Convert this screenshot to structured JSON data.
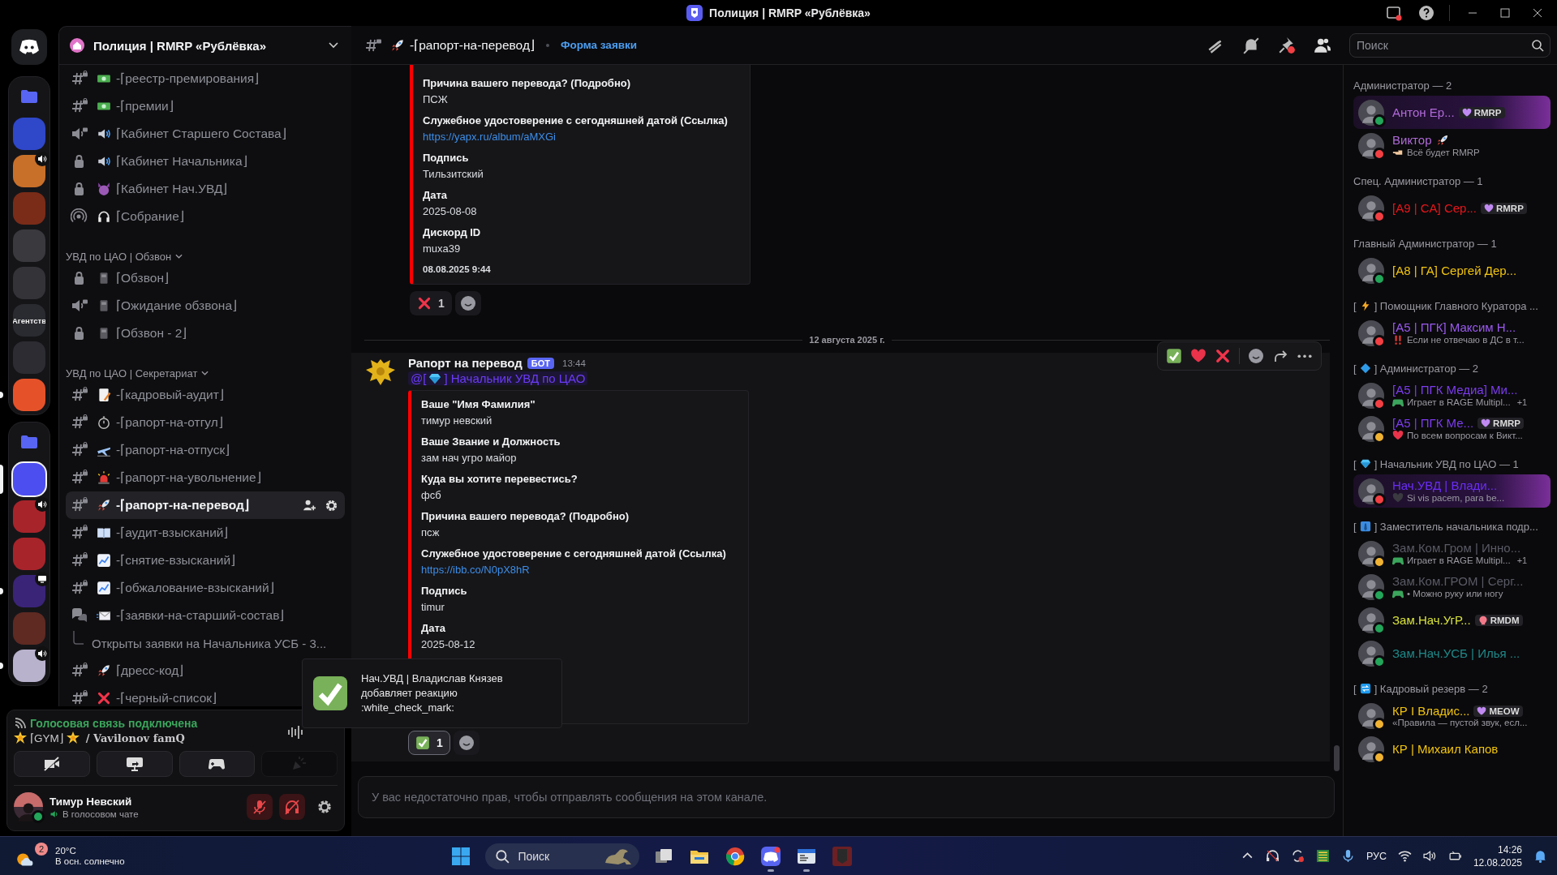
{
  "window": {
    "title": "Полиция | RMRP «Рублёвка»"
  },
  "rail": [
    {
      "kind": "home"
    },
    {
      "kind": "folder",
      "children": [
        {
          "color": "#2f47c9",
          "selected": false,
          "unread": false
        },
        {
          "color": "#c8702a",
          "selected": false,
          "unread": false,
          "activity": {
            "kind": "voice"
          }
        },
        {
          "color": "#7a2c18",
          "selected": false,
          "unread": false
        },
        {
          "color": "#3a3a3e",
          "selected": false,
          "unread": false
        },
        {
          "color": "#333338",
          "selected": false,
          "unread": false
        },
        {
          "color": "#2a2b30",
          "selected": false,
          "unread": false,
          "label": "Агентств"
        },
        {
          "color": "#2c2c32",
          "selected": false,
          "unread": false
        },
        {
          "color": "#e5522a",
          "selected": false,
          "unread": true
        }
      ]
    },
    {
      "kind": "folder",
      "children": [
        {
          "color": "#4d4ef0",
          "selected": true,
          "unread": false
        },
        {
          "color": "#a8242b",
          "selected": false,
          "unread": false,
          "activity": {
            "kind": "voice"
          }
        },
        {
          "color": "#a8242b",
          "selected": false,
          "unread": false
        },
        {
          "color": "#3a2478",
          "selected": false,
          "unread": true,
          "activity": {
            "kind": "screen"
          }
        },
        {
          "color": "#5e2a22",
          "selected": false,
          "unread": false
        },
        {
          "color": "#b9b2cc",
          "selected": false,
          "unread": true,
          "activity": {
            "kind": "voice"
          }
        }
      ]
    }
  ],
  "sidebar": {
    "server_name": "Полиция | RMRP «Рублёвка»",
    "categories": [
      {
        "channels": [
          {
            "kind": "text",
            "emoji": {
              "kind": "money"
            },
            "name": "-⌈реестр-премирования⌋",
            "selected": false
          },
          {
            "kind": "text",
            "emoji": {
              "kind": "money"
            },
            "name": "-⌈премии⌋",
            "selected": false
          },
          {
            "kind": "voice",
            "emoji": {
              "kind": "speaker"
            },
            "name": "⌈Кабинет Старшего Состава⌋",
            "selected": false
          },
          {
            "kind": "locked",
            "emoji": {
              "kind": "speaker"
            },
            "name": "⌈Кабинет Начальника⌋",
            "selected": false
          },
          {
            "kind": "locked",
            "emoji": {
              "kind": "devil"
            },
            "name": "⌈Кабинет Нач.УВД⌋",
            "selected": false
          },
          {
            "kind": "stage",
            "emoji": {
              "kind": "headphones"
            },
            "name": "⌈Собрание⌋",
            "selected": false
          }
        ]
      },
      {
        "name": "УВД по ЦАО | Обзвон",
        "expanded": true,
        "channels": [
          {
            "kind": "locked",
            "emoji": {
              "kind": "pager"
            },
            "name": "⌈Обзвон⌋",
            "selected": false
          },
          {
            "kind": "voice",
            "emoji": {
              "kind": "pager"
            },
            "name": "⌈Ожидание обзвона⌋",
            "selected": false
          },
          {
            "kind": "locked",
            "emoji": {
              "kind": "pager"
            },
            "name": "⌈Обзвон - 2⌋",
            "selected": false
          }
        ]
      },
      {
        "name": "УВД по ЦАО | Секретариат",
        "expanded": true,
        "channels": [
          {
            "kind": "text",
            "emoji": {
              "kind": "memo"
            },
            "name": "-⌈кадровый-аудит⌋",
            "selected": false
          },
          {
            "kind": "text",
            "emoji": {
              "kind": "timer"
            },
            "name": "-⌈рапорт-на-отгул⌋",
            "selected": false
          },
          {
            "kind": "text",
            "emoji": {
              "kind": "plane"
            },
            "name": "-⌈рапорт-на-отпуск⌋",
            "selected": false
          },
          {
            "kind": "text",
            "emoji": {
              "kind": "siren"
            },
            "name": "-⌈рапорт-на-увольнение⌋",
            "selected": false
          },
          {
            "kind": "text",
            "emoji": {
              "kind": "rocket"
            },
            "name": "-⌈рапорт-на-перевод⌋",
            "selected": true
          },
          {
            "kind": "text",
            "emoji": {
              "kind": "book"
            },
            "name": "-⌈аудит-взысканий⌋",
            "selected": false
          },
          {
            "kind": "text",
            "emoji": {
              "kind": "chart"
            },
            "name": "-⌈снятие-взысканий⌋",
            "selected": false
          },
          {
            "kind": "text",
            "emoji": {
              "kind": "chart"
            },
            "name": "-⌈обжалование-взысканий⌋",
            "selected": false
          },
          {
            "kind": "forum",
            "emoji": {
              "kind": "envelope"
            },
            "name": "-⌈заявки-на-старший-состав⌋",
            "selected": false,
            "children": [
              {
                "name": "Открыты заявки на Начальника УСБ - 3..."
              }
            ]
          },
          {
            "kind": "text",
            "emoji": {
              "kind": "rocket"
            },
            "name": "⌈дресс-код⌋",
            "selected": false
          },
          {
            "kind": "text",
            "emoji": {
              "kind": "cross"
            },
            "name": "-⌈черный-список⌋",
            "selected": false
          }
        ]
      }
    ]
  },
  "voice_panel": {
    "status": "Голосовая связь подключена",
    "channel": "⌈GYM⌋",
    "server": "/ Vavilonov famQ",
    "buttons": [
      {
        "kind": "camera",
        "disabled": false
      },
      {
        "kind": "screen",
        "disabled": false
      },
      {
        "kind": "activity",
        "disabled": false
      },
      {
        "kind": "soundboard",
        "disabled": true
      }
    ]
  },
  "user_panel": {
    "name": "Тимур Невский",
    "status_text": "В голосовом чате",
    "status": {
      "kind": "online"
    },
    "muted": true,
    "deafened": true
  },
  "channel_header": {
    "emoji": {
      "kind": "rocket"
    },
    "name": "-⌈рапорт-на-перевод⌋",
    "topic": "Форма заявки",
    "search": {
      "placeholder": "Поиск"
    }
  },
  "chat": {
    "earlier": {
      "embed": {
        "fields": [
          {
            "name": "Причина вашего перевода? (Подробно)",
            "value": "ПСЖ",
            "kind": "text"
          },
          {
            "name": "Служебное удостоверение с сегодняшней датой  (Ссылка)",
            "value": "https://yapx.ru/album/aMXGi",
            "kind": "link"
          },
          {
            "name": "Подпись",
            "value": "Тильзитский",
            "kind": "text"
          },
          {
            "name": "Дата",
            "value": "2025-08-08",
            "kind": "text"
          },
          {
            "name": "Дискорд ID",
            "value": "muxa39",
            "kind": "text"
          }
        ],
        "footer": "08.08.2025 9:44"
      },
      "reactions": [
        {
          "emoji": {
            "kind": "cross"
          },
          "count": "1",
          "selected": false
        }
      ]
    },
    "date_divider": "12 августа 2025 г.",
    "message": {
      "author": "Рапорт на перевод",
      "tag": "БОТ",
      "time": "13:44",
      "hovered": true,
      "mention": {
        "before": "@[",
        "emoji": {
          "kind": "gem"
        },
        "after": "] Начальник УВД по ЦАО"
      },
      "embed": {
        "fields": [
          {
            "name": "Ваше \"Имя Фамилия\"",
            "value": "тимур невский",
            "kind": "text"
          },
          {
            "name": "Ваше  Звание и Должность",
            "value": "зам нач угро майор",
            "kind": "text"
          },
          {
            "name": "Куда вы хотите перевестись?",
            "value": "фсб",
            "kind": "text"
          },
          {
            "name": "Причина вашего перевода? (Подробно)",
            "value": "псж",
            "kind": "text"
          },
          {
            "name": "Служебное удостоверение с сегодняшней датой  (Ссылка)",
            "value": "https://ibb.co/N0pX8hR",
            "kind": "link"
          },
          {
            "name": "Подпись",
            "value": "timur",
            "kind": "text"
          },
          {
            "name": "Дата",
            "value": "2025-08-12",
            "kind": "text"
          }
        ]
      },
      "reactions": [
        {
          "emoji": {
            "kind": "check"
          },
          "count": "1",
          "selected": true
        }
      ],
      "quick_reactions": [
        {
          "emoji": {
            "kind": "check"
          }
        },
        {
          "emoji": {
            "kind": "heart"
          }
        },
        {
          "emoji": {
            "kind": "cross"
          }
        }
      ]
    },
    "composer": {
      "placeholder": "У вас недостаточно прав, чтобы отправлять сообщения на этом канале."
    }
  },
  "toast": {
    "emoji": {
      "kind": "check"
    },
    "text": "Нач.УВД | Владислав Князев добавляет реакцию :white_check_mark:"
  },
  "members": {
    "groups": [
      {
        "label": "Администратор — 2",
        "members": [
          {
            "name": "Антон Ер...",
            "color": "#b06ad8",
            "status": {
              "kind": "online"
            },
            "highlighted": true,
            "tag": {
              "emoji": {
                "kind": "purpleheart"
              },
              "text": "RMRP"
            }
          },
          {
            "name": "Виктор",
            "name_emoji": {
              "kind": "rocket"
            },
            "color": "#b06ad8",
            "status": {
              "kind": "dnd"
            },
            "highlighted": false,
            "activity": {
              "emoji": {
                "kind": "hand"
              },
              "text": "Всё будет RMRP"
            }
          }
        ]
      },
      {
        "label": "Спец. Администратор — 1",
        "members": [
          {
            "name": "[A9 | CA] Сер...",
            "color": "#e8161b",
            "status": {
              "kind": "dnd"
            },
            "highlighted": false,
            "tag": {
              "emoji": {
                "kind": "purpleheart"
              },
              "text": "RMRP"
            }
          }
        ]
      },
      {
        "label": "Главный Администратор — 1",
        "members": [
          {
            "name": "[A8 | ГА] Сергей Дер...",
            "color": "#f1c40f",
            "status": {
              "kind": "online"
            },
            "highlighted": false
          }
        ]
      },
      {
        "open": "[",
        "emoji": {
          "kind": "bolt"
        },
        "label": "] Помощник Главного Куратора ...",
        "members": [
          {
            "name": "[A5 | ПГК] Максим Н...",
            "color": "#9b59f0",
            "status": {
              "kind": "dnd"
            },
            "highlighted": false,
            "activity": {
              "emoji": {
                "kind": "bangbang"
              },
              "text": "Если не отвечаю в ДС в т..."
            }
          }
        ]
      },
      {
        "open": "[",
        "emoji": {
          "kind": "diamond"
        },
        "label": "] Администратор — 2",
        "members": [
          {
            "name": "[A5 | ПГК Медиа] Ми...",
            "color": "#7d3cf0",
            "status": {
              "kind": "dnd"
            },
            "highlighted": false,
            "activity": {
              "emoji": {
                "kind": "gamepad"
              },
              "text": "Играет в RAGE Multipl...",
              "extra": "+1"
            }
          },
          {
            "name": "[A5 | ПГК Ме...",
            "color": "#7d3cf0",
            "status": {
              "kind": "idle"
            },
            "highlighted": false,
            "tag": {
              "emoji": {
                "kind": "purpleheart"
              },
              "text": "RMRP"
            },
            "activity": {
              "emoji": {
                "kind": "heart"
              },
              "text": "По всем вопросам к Викт..."
            }
          }
        ]
      },
      {
        "open": "[",
        "emoji": {
          "kind": "gem"
        },
        "label": "] Начальник УВД по ЦАО — 1",
        "members": [
          {
            "name": "Нач.УВД | Влади...",
            "color": "#6a2ef5",
            "status": {
              "kind": "dnd"
            },
            "highlighted": true,
            "activity": {
              "emoji": {
                "kind": "darkheart"
              },
              "text": "Si vis pacem, para be..."
            }
          }
        ]
      },
      {
        "open": "[",
        "emoji": {
          "kind": "tie"
        },
        "label": "] Заместитель начальника подр...",
        "members": [
          {
            "name": "Зам.Ком.Гром | Инно...",
            "color": "#5a5a66",
            "status": {
              "kind": "idle"
            },
            "highlighted": false,
            "activity": {
              "emoji": {
                "kind": "gamepad"
              },
              "text": "Играет в RAGE Multipl...",
              "extra": "+1"
            }
          },
          {
            "name": "Зам.Ком.ГРОМ | Серг...",
            "color": "#5a5a66",
            "status": {
              "kind": "online"
            },
            "highlighted": false,
            "activity": {
              "emoji": {
                "kind": "gamepad"
              },
              "text": "• Можно руку или ногу"
            }
          },
          {
            "name": "Зам.Нач.УгР...",
            "color": "#d8e23c",
            "status": {
              "kind": "online"
            },
            "highlighted": false,
            "tag": {
              "emoji": {
                "kind": "skull"
              },
              "text": "RMDM"
            }
          },
          {
            "name": "Зам.Нач.УСБ | Илья ...",
            "color": "#1f8a8a",
            "status": {
              "kind": "online"
            },
            "highlighted": false
          }
        ]
      },
      {
        "open": "[",
        "emoji": {
          "kind": "repeat"
        },
        "label": "] Кадровый резерв — 2",
        "members": [
          {
            "name": "КР I Владис...",
            "color": "#f1c40f",
            "status": {
              "kind": "idle"
            },
            "highlighted": false,
            "tag": {
              "emoji": {
                "kind": "purpleheart"
              },
              "text": "MEOW"
            },
            "activity": {
              "text": "«Правила — пустой звук, есл..."
            }
          },
          {
            "name": "КР | Михаил Капов",
            "color": "#f1c40f",
            "status": {
              "kind": "idle"
            },
            "highlighted": false
          }
        ]
      }
    ]
  },
  "taskbar": {
    "weather": {
      "badge": "2",
      "temp": "20°C",
      "desc": "В осн. солнечно"
    },
    "search": "Поиск",
    "apps": [
      {
        "kind": "taskview",
        "running": false
      },
      {
        "kind": "explorer",
        "running": false
      },
      {
        "kind": "browser",
        "running": false
      },
      {
        "kind": "chat",
        "running": true
      },
      {
        "kind": "terminal",
        "running": true
      },
      {
        "kind": "store",
        "running": false
      }
    ],
    "language": "РУС",
    "time": "14:26",
    "date": "12.08.2025"
  }
}
